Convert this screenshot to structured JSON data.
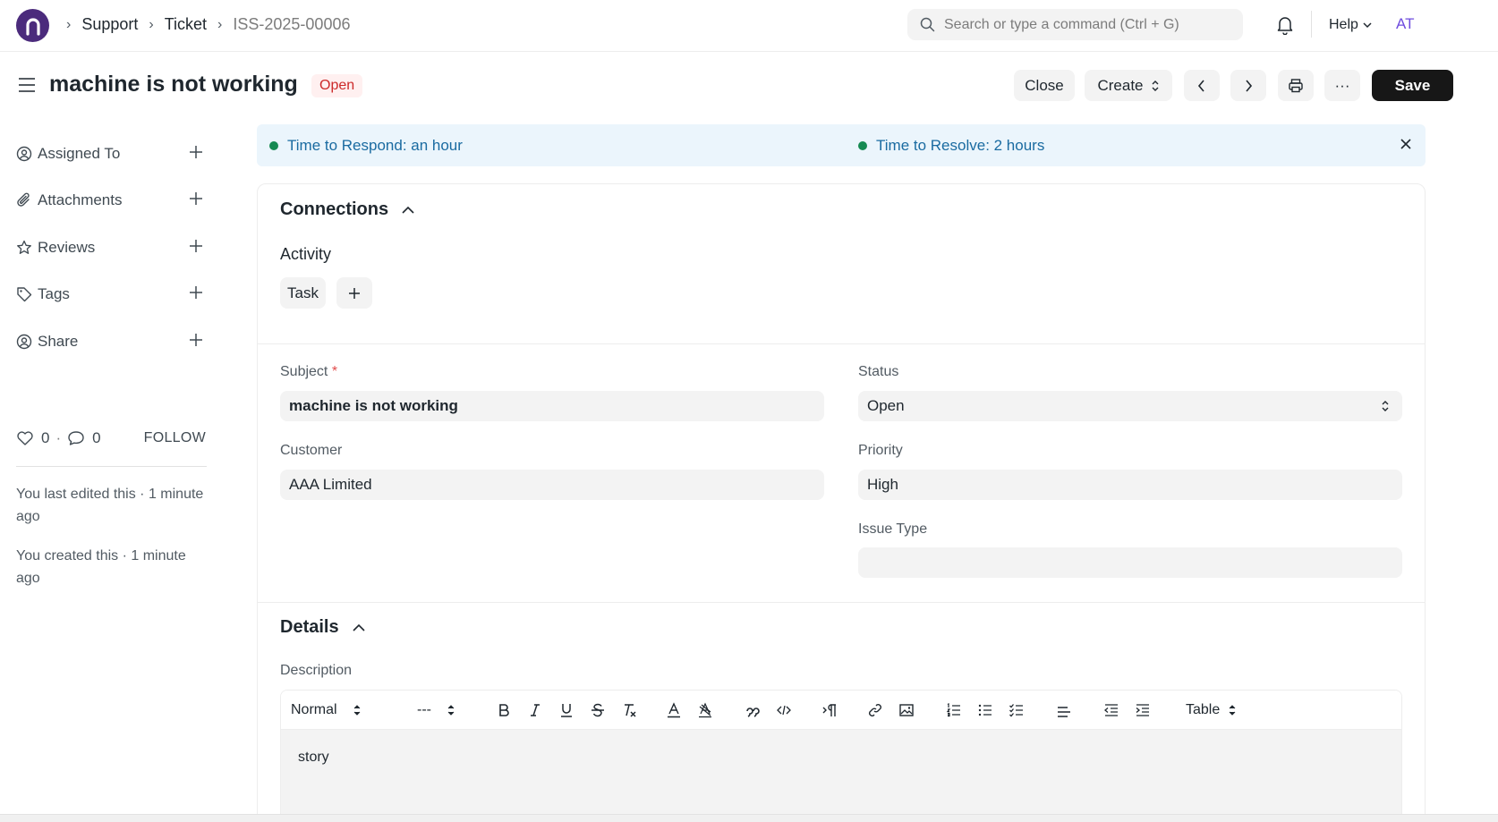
{
  "navbar": {
    "breadcrumbs": [
      "Support",
      "Ticket",
      "ISS-2025-00006"
    ],
    "search_placeholder": "Search or type a command (Ctrl + G)",
    "help_label": "Help",
    "avatar_initials": "AT"
  },
  "page": {
    "title": "machine is not working",
    "status_badge": "Open",
    "buttons": {
      "close": "Close",
      "create": "Create",
      "save": "Save",
      "more": "···"
    }
  },
  "sidebar": {
    "items": [
      {
        "label": "Assigned To",
        "icon": "user-assign-icon"
      },
      {
        "label": "Attachments",
        "icon": "paperclip-icon"
      },
      {
        "label": "Reviews",
        "icon": "star-icon"
      },
      {
        "label": "Tags",
        "icon": "tag-icon"
      },
      {
        "label": "Share",
        "icon": "share-user-icon"
      }
    ],
    "likes_count": "0",
    "comments_count": "0",
    "follow_label": "FOLLOW",
    "notes": [
      "You last edited this · 1 minute ago",
      "You created this · 1 minute ago"
    ]
  },
  "sla": {
    "respond": "Time to Respond: an hour",
    "resolve": "Time to Resolve: 2 hours"
  },
  "connections": {
    "title": "Connections",
    "activity_label": "Activity",
    "task_label": "Task"
  },
  "form": {
    "subject_label": "Subject",
    "subject_required": "*",
    "subject_value": "machine is not working",
    "status_label": "Status",
    "status_value": "Open",
    "customer_label": "Customer",
    "customer_value": "AAA Limited",
    "priority_label": "Priority",
    "priority_value": "High",
    "issue_type_label": "Issue Type",
    "issue_type_value": ""
  },
  "details": {
    "title": "Details",
    "description_label": "Description",
    "toolbar": {
      "paragraph_style": "Normal",
      "font_size": "---",
      "table_label": "Table"
    },
    "description_value": "story"
  },
  "colors": {
    "accent_dark": "#171717",
    "status_open": "#cc2929",
    "sla_text": "#1a6ba1",
    "sla_dot": "#168a52",
    "logo": "#4b2b7c"
  }
}
